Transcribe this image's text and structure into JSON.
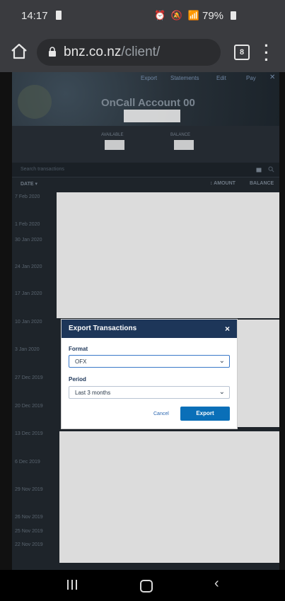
{
  "status_bar": {
    "time": "14:17",
    "battery_pct": "79%",
    "icons": "⏰ 🔕 📶"
  },
  "browser": {
    "domain": "bnz.co.nz",
    "path": "/client/",
    "tab_count": "8"
  },
  "account": {
    "toolbar": {
      "export": "Export",
      "statements": "Statements",
      "edit": "Edit",
      "pay": "Pay",
      "close": "✕"
    },
    "title": "OnCall Account 00",
    "available_label": "AVAILABLE",
    "balance_label": "BALANCE"
  },
  "transactions": {
    "search_placeholder": "Search transactions",
    "col_date": "DATE ▾",
    "col_amount": "↕ AMOUNT",
    "col_balance": "BALANCE",
    "dates": [
      "7 Feb 2020",
      "1 Feb 2020",
      "30 Jan 2020",
      "24 Jan 2020",
      "17 Jan 2020",
      "10 Jan 2020",
      "3 Jan 2020",
      "27 Dec 2019",
      "20 Dec 2019",
      "13 Dec 2019",
      "6 Dec 2019",
      "29 Nov 2019",
      "26 Nov 2019",
      "25 Nov 2019",
      "22 Nov 2019"
    ]
  },
  "modal": {
    "title": "Export Transactions",
    "close": "×",
    "format_label": "Format",
    "format_value": "OFX",
    "period_label": "Period",
    "period_value": "Last 3 months",
    "cancel_label": "Cancel",
    "export_label": "Export"
  }
}
